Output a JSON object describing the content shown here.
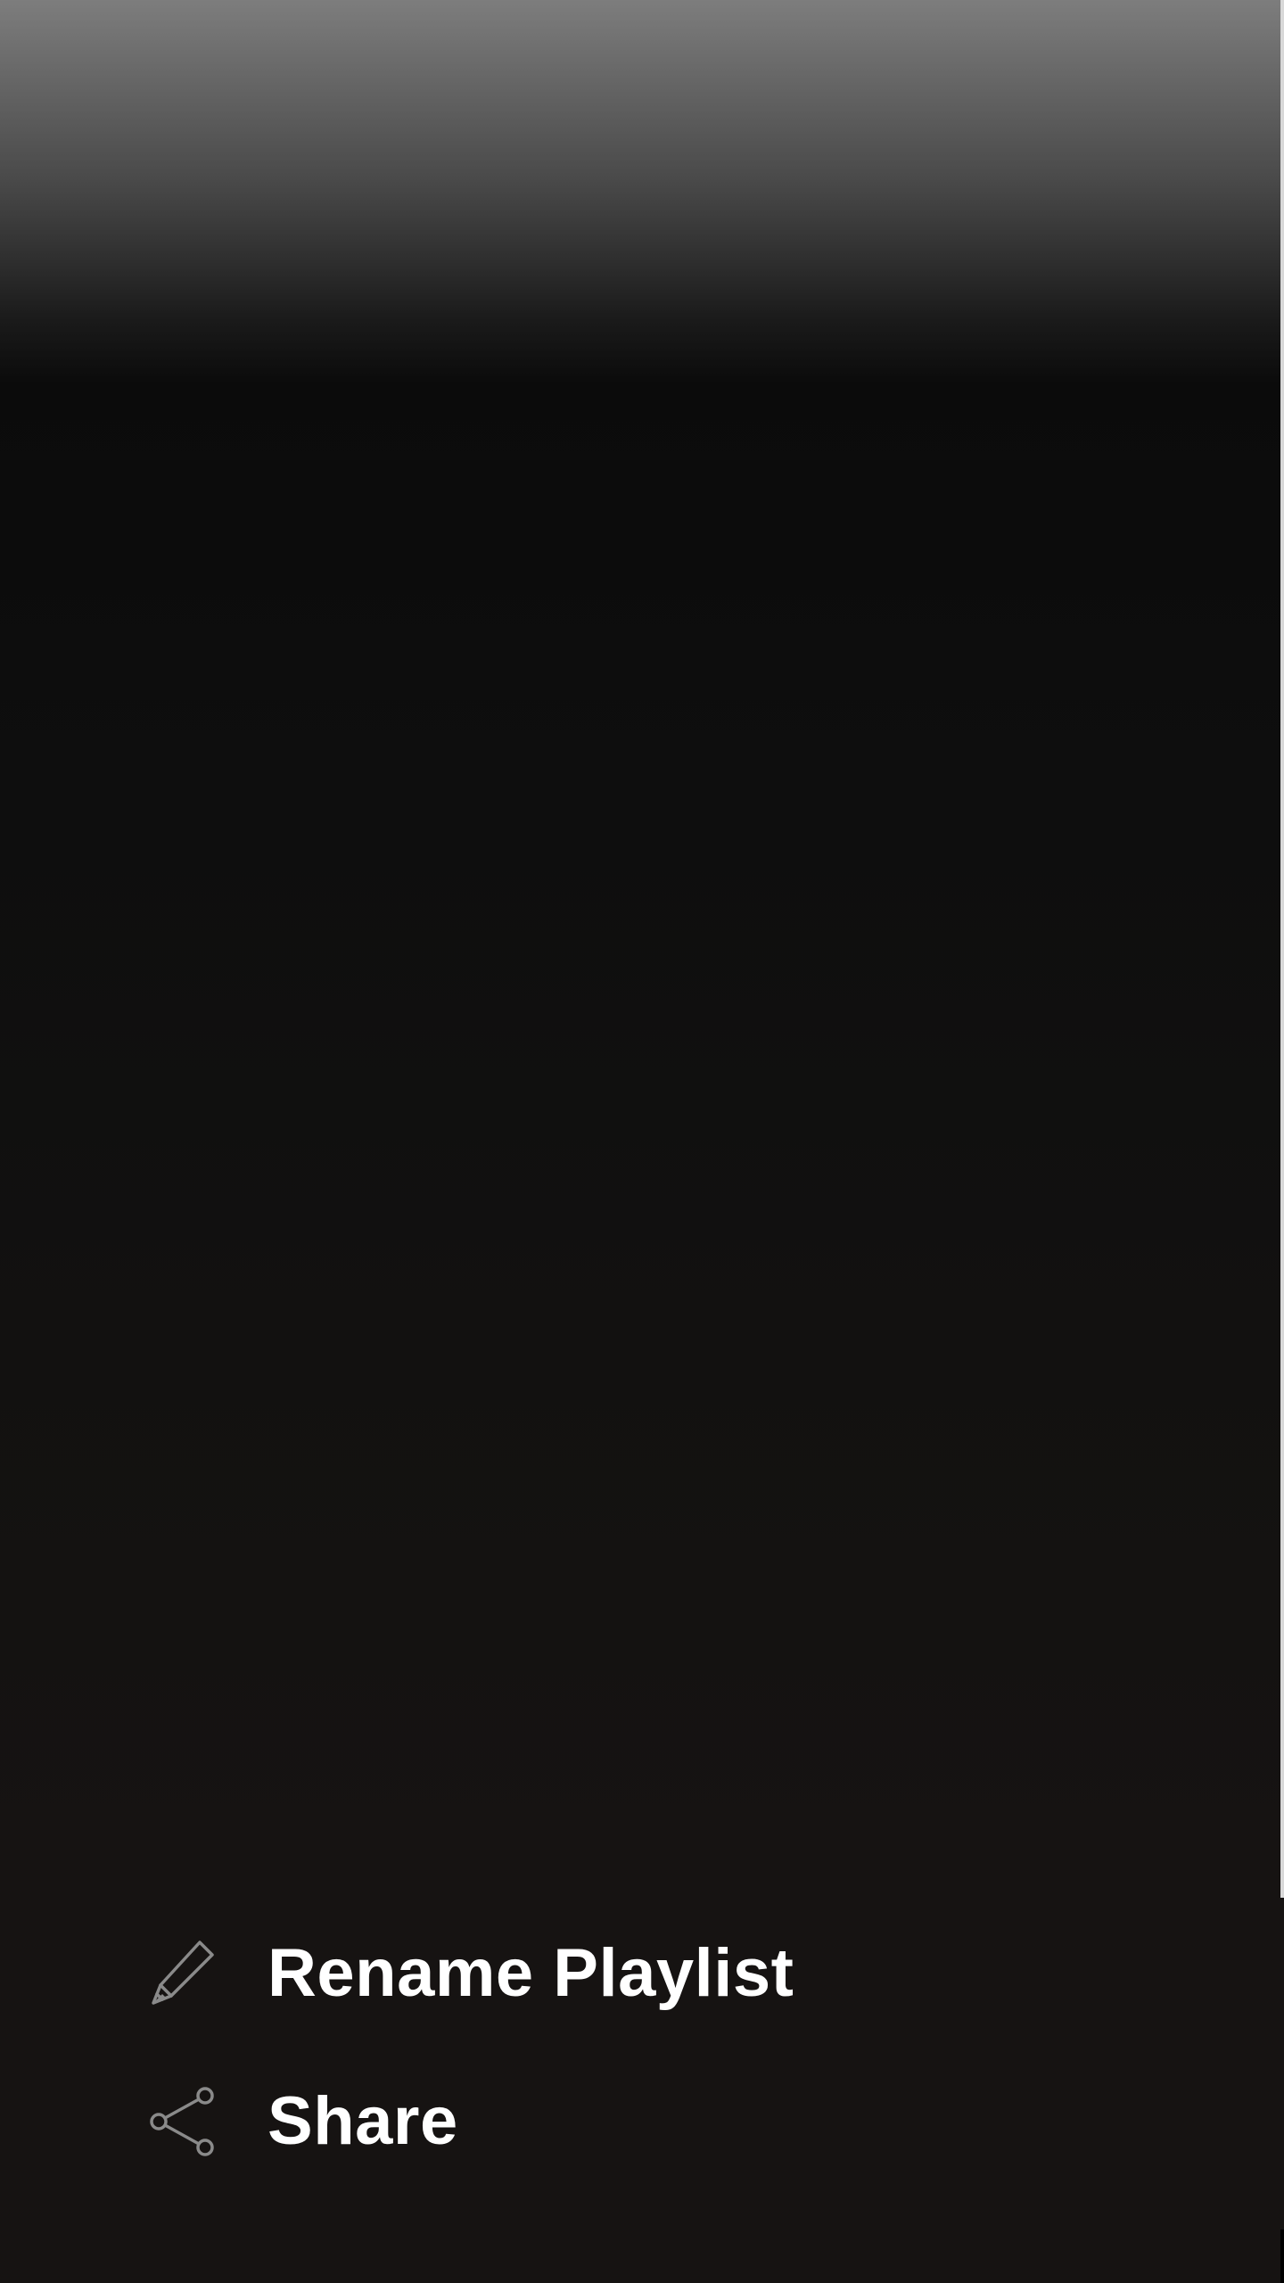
{
  "menu": {
    "items": [
      {
        "label": "Rename Playlist",
        "icon": "pencil-icon"
      },
      {
        "label": "Share",
        "icon": "share-icon"
      }
    ]
  },
  "colors": {
    "background": "#161312",
    "text": "#ffffff",
    "icon": "#8a8a8a"
  }
}
